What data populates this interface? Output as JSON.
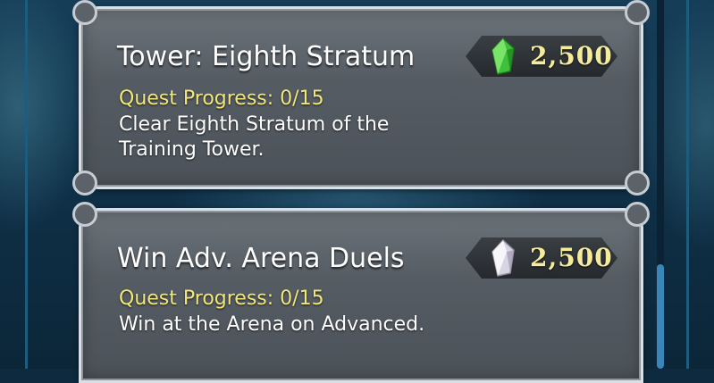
{
  "quests": [
    {
      "title": "Tower: Eighth Stratum",
      "progress": "Quest Progress: 0/15",
      "description": "Clear Eighth Stratum of the Training Tower.",
      "reward_icon": "green-crystal-icon",
      "reward_amount": "2,500",
      "crystal_color": "#3fbf3a"
    },
    {
      "title": "Win Adv. Arena Duels",
      "progress": "Quest Progress: 0/15",
      "description": "Win at the Arena on Advanced.",
      "reward_icon": "white-crystal-icon",
      "reward_amount": "2,500",
      "crystal_color": "#d8d4e4"
    }
  ],
  "colors": {
    "progress_text": "#f2e77c",
    "reward_text": "#f4ec9c",
    "card_border": "#d9dfe4"
  }
}
